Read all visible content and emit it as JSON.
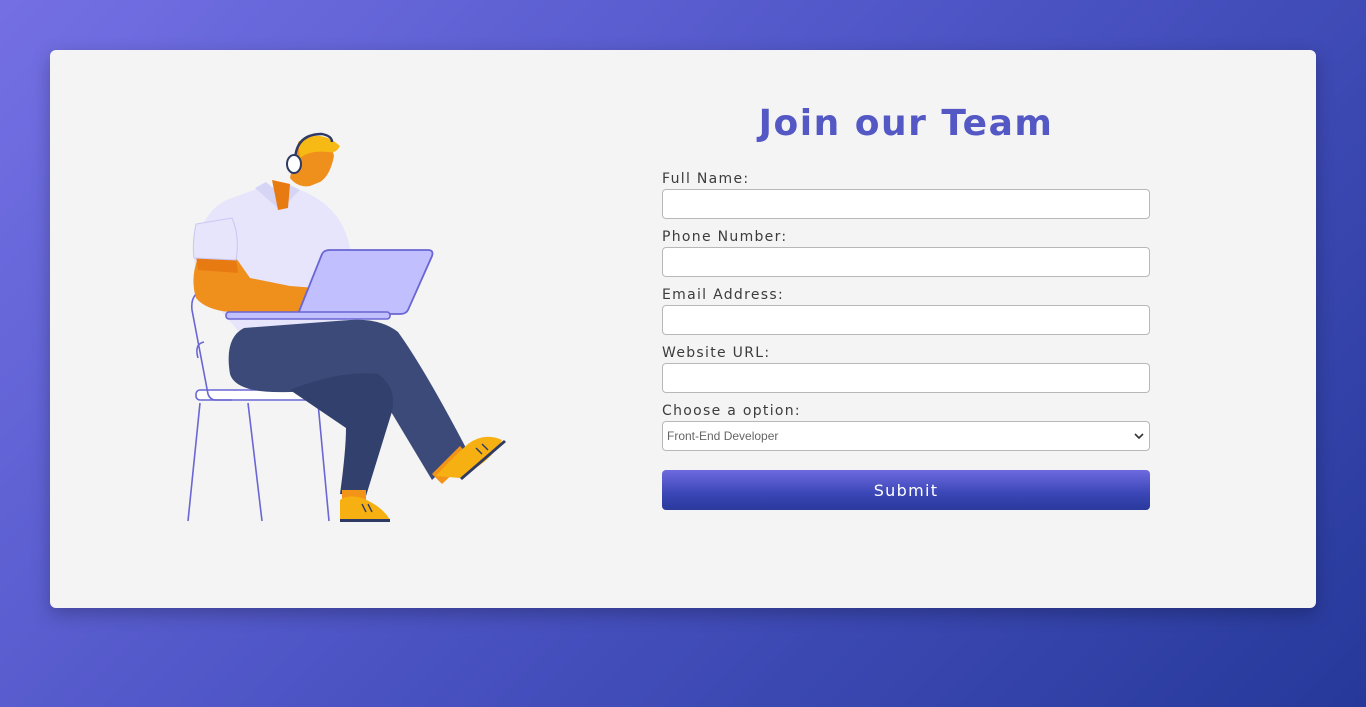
{
  "form": {
    "title": "Join our Team",
    "fields": [
      {
        "label": "Full Name:",
        "value": "",
        "placeholder": ""
      },
      {
        "label": "Phone Number:",
        "value": "",
        "placeholder": ""
      },
      {
        "label": "Email Address:",
        "value": "",
        "placeholder": ""
      },
      {
        "label": "Website URL:",
        "value": "",
        "placeholder": ""
      }
    ],
    "select": {
      "label": "Choose a option:",
      "selected": "Front-End Developer"
    },
    "submit_label": "Submit"
  },
  "icons": {
    "illustration": "person-with-laptop-illustration",
    "select_arrow": "chevron-down-icon"
  },
  "colors": {
    "title": "#5358c4",
    "card_background": "#f4f4f4",
    "background_gradient_start": "#7470e4",
    "background_gradient_end": "#26399a",
    "button_gradient_start": "#6d6adf",
    "button_gradient_end": "#2a3a9c"
  }
}
